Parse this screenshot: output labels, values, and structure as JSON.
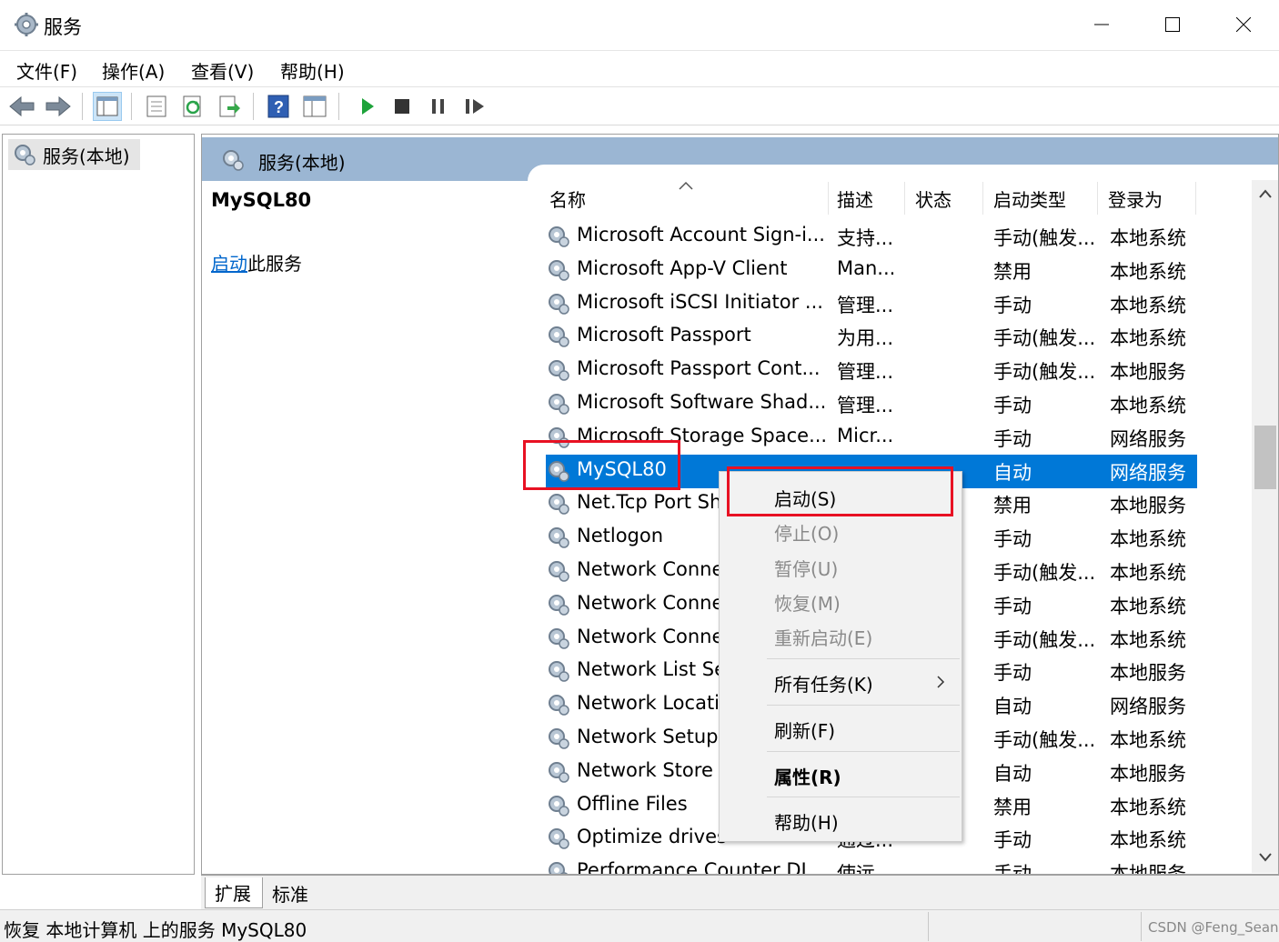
{
  "window": {
    "title": "服务"
  },
  "menu": [
    "文件(F)",
    "操作(A)",
    "查看(V)",
    "帮助(H)"
  ],
  "tree": {
    "root": "服务(本地)"
  },
  "panel": {
    "header": "服务(本地)",
    "selected_service": "MySQL80",
    "start_link": "启动",
    "start_link_suffix": "此服务"
  },
  "columns": [
    "名称",
    "描述",
    "状态",
    "启动类型",
    "登录为"
  ],
  "rows": [
    {
      "name": "Microsoft Account Sign-i...",
      "desc": "支持...",
      "status": "",
      "startup": "手动(触发...",
      "logon": "本地系统"
    },
    {
      "name": "Microsoft App-V Client",
      "desc": "Man...",
      "status": "",
      "startup": "禁用",
      "logon": "本地系统"
    },
    {
      "name": "Microsoft iSCSI Initiator ...",
      "desc": "管理...",
      "status": "",
      "startup": "手动",
      "logon": "本地系统"
    },
    {
      "name": "Microsoft Passport",
      "desc": "为用...",
      "status": "",
      "startup": "手动(触发...",
      "logon": "本地系统"
    },
    {
      "name": "Microsoft Passport Cont...",
      "desc": "管理...",
      "status": "",
      "startup": "手动(触发...",
      "logon": "本地服务"
    },
    {
      "name": "Microsoft Software Shad...",
      "desc": "管理...",
      "status": "",
      "startup": "手动",
      "logon": "本地系统"
    },
    {
      "name": "Microsoft Storage Space...",
      "desc": "Micr...",
      "status": "",
      "startup": "手动",
      "logon": "网络服务"
    },
    {
      "name": "MySQL80",
      "desc": "",
      "status": "",
      "startup": "自动",
      "logon": "网络服务"
    },
    {
      "name": "Net.Tcp Port Sh",
      "desc": "",
      "status": "",
      "startup": "禁用",
      "logon": "本地服务"
    },
    {
      "name": "Netlogon",
      "desc": "",
      "status": "",
      "startup": "手动",
      "logon": "本地系统"
    },
    {
      "name": "Network Conne",
      "desc": "",
      "status": ".",
      "startup": "手动(触发...",
      "logon": "本地系统"
    },
    {
      "name": "Network Conne",
      "desc": "",
      "status": "",
      "startup": "手动",
      "logon": "本地系统"
    },
    {
      "name": "Network Conne",
      "desc": "",
      "status": "",
      "startup": "手动(触发...",
      "logon": "本地系统"
    },
    {
      "name": "Network List Se",
      "desc": "",
      "status": ".",
      "startup": "手动",
      "logon": "本地服务"
    },
    {
      "name": "Network Locati",
      "desc": "",
      "status": ".",
      "startup": "自动",
      "logon": "网络服务"
    },
    {
      "name": "Network Setup",
      "desc": "",
      "status": "",
      "startup": "手动(触发...",
      "logon": "本地系统"
    },
    {
      "name": "Network Store",
      "desc": "",
      "status": ".",
      "startup": "自动",
      "logon": "本地服务"
    },
    {
      "name": "Offline Files",
      "desc": "",
      "status": "",
      "startup": "禁用",
      "logon": "本地系统"
    },
    {
      "name": "Optimize drives",
      "desc": "通过...",
      "status": "",
      "startup": "手动",
      "logon": "本地系统"
    },
    {
      "name": "Performance Counter DL...",
      "desc": "使远...",
      "status": "",
      "startup": "手动",
      "logon": "本地服务"
    }
  ],
  "context_menu": {
    "start": "启动(S)",
    "stop": "停止(O)",
    "pause": "暂停(U)",
    "resume": "恢复(M)",
    "restart": "重新启动(E)",
    "all_tasks": "所有任务(K)",
    "refresh": "刷新(F)",
    "properties": "属性(R)",
    "help": "帮助(H)"
  },
  "tabs": [
    "扩展",
    "标准"
  ],
  "status": {
    "text": "恢复 本地计算机 上的服务 MySQL80",
    "watermark": "CSDN @Feng_Sean"
  },
  "colors": {
    "selection": "#0078d7",
    "header_band": "#9bb6d3",
    "annotation_box": "#e81123",
    "link": "#0066cc"
  },
  "icons": [
    "services-gear-icon",
    "back-arrow-icon",
    "forward-arrow-icon",
    "play-icon",
    "stop-icon",
    "pause-icon",
    "resume-icon",
    "help-icon"
  ]
}
